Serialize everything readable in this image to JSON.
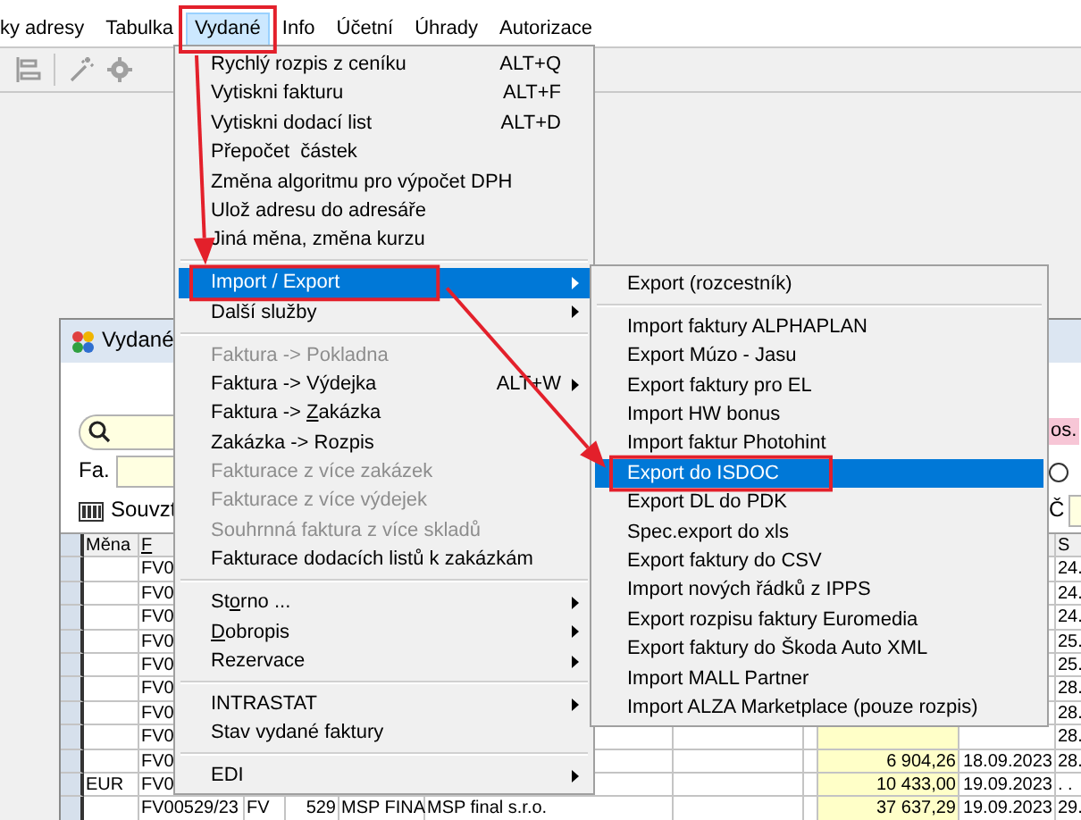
{
  "menu_bar": [
    {
      "label": "ky adresy",
      "selected": false
    },
    {
      "label": "Tabulka",
      "selected": false
    },
    {
      "label": "Vydané",
      "selected": true
    },
    {
      "label": "Info",
      "selected": false
    },
    {
      "label": "Účetní",
      "selected": false
    },
    {
      "label": "Úhrady",
      "selected": false
    },
    {
      "label": "Autorizace",
      "selected": false
    }
  ],
  "vydane_menu": [
    {
      "kind": "item",
      "label": "Rychlý rozpis z ceníku",
      "shortcut": "ALT+Q",
      "disabled": false,
      "selected": false
    },
    {
      "kind": "item",
      "label": "Vytiskni fakturu",
      "shortcut": "ALT+F",
      "disabled": false,
      "selected": false
    },
    {
      "kind": "item",
      "label": "Vytiskni dodací list",
      "shortcut": "ALT+D",
      "disabled": false,
      "selected": false
    },
    {
      "kind": "item",
      "label": "Přepočet  částek",
      "disabled": false,
      "selected": false
    },
    {
      "kind": "item",
      "label": "Změna algoritmu pro výpočet DPH",
      "disabled": false,
      "selected": false
    },
    {
      "kind": "item",
      "label": "Ulož adresu do adresáře",
      "disabled": false,
      "selected": false
    },
    {
      "kind": "item",
      "label": "Jiná měna, změna kurzu",
      "disabled": false,
      "selected": false
    },
    {
      "kind": "separator"
    },
    {
      "kind": "item",
      "label": "Import / Export",
      "submenu": true,
      "disabled": false,
      "selected": true
    },
    {
      "kind": "item",
      "label": "Další služby",
      "submenu": true,
      "disabled": false,
      "selected": false
    },
    {
      "kind": "separator"
    },
    {
      "kind": "item",
      "label": "Faktura -> Pokladna",
      "disabled": true,
      "selected": false
    },
    {
      "kind": "item",
      "label": "Faktura -> Výdejka",
      "shortcut": "ALT+W",
      "submenu": true,
      "disabled": false,
      "selected": false
    },
    {
      "kind": "item",
      "label_parts": [
        {
          "text": "Faktura -> ",
          "underlined": false
        },
        {
          "text": "Z",
          "underlined": true
        },
        {
          "text": "akázka",
          "underlined": false
        }
      ],
      "disabled": false,
      "selected": false
    },
    {
      "kind": "item",
      "label": "Zakázka -> Rozpis",
      "disabled": false,
      "selected": false
    },
    {
      "kind": "item",
      "label": "Fakturace z více zakázek",
      "disabled": true,
      "selected": false
    },
    {
      "kind": "item",
      "label": "Fakturace z více výdejek",
      "disabled": true,
      "selected": false
    },
    {
      "kind": "item",
      "label": "Souhrnná faktura z více skladů",
      "disabled": true,
      "selected": false
    },
    {
      "kind": "item",
      "label": "Fakturace dodacích listů k zakázkám",
      "disabled": false,
      "selected": false
    },
    {
      "kind": "separator"
    },
    {
      "kind": "item",
      "label_parts": [
        {
          "text": "St",
          "underlined": false
        },
        {
          "text": "o",
          "underlined": true
        },
        {
          "text": "rno ...",
          "underlined": false
        }
      ],
      "submenu": true,
      "disabled": false,
      "selected": false
    },
    {
      "kind": "item",
      "label_parts": [
        {
          "text": "D",
          "underlined": true
        },
        {
          "text": "obropis",
          "underlined": false
        }
      ],
      "submenu": true,
      "disabled": false,
      "selected": false
    },
    {
      "kind": "item",
      "label": "Rezervace",
      "submenu": true,
      "disabled": false,
      "selected": false
    },
    {
      "kind": "separator"
    },
    {
      "kind": "item",
      "label": "INTRASTAT",
      "submenu": true,
      "disabled": false,
      "selected": false
    },
    {
      "kind": "item",
      "label": "Stav vydané faktury",
      "disabled": false,
      "selected": false
    },
    {
      "kind": "separator"
    },
    {
      "kind": "item",
      "label": "EDI",
      "submenu": true,
      "disabled": false,
      "selected": false
    }
  ],
  "import_export_menu": [
    {
      "kind": "item",
      "label": "Export (rozcestník)",
      "disabled": false,
      "selected": false
    },
    {
      "kind": "separator"
    },
    {
      "kind": "item",
      "label": "Import faktury ALPHAPLAN",
      "disabled": false,
      "selected": false
    },
    {
      "kind": "item",
      "label": "Export Múzo - Jasu",
      "disabled": false,
      "selected": false
    },
    {
      "kind": "item",
      "label": "Export faktury pro EL",
      "disabled": false,
      "selected": false
    },
    {
      "kind": "item",
      "label": "Import HW bonus",
      "disabled": false,
      "selected": false
    },
    {
      "kind": "item",
      "label": "Import faktur Photohint",
      "disabled": false,
      "selected": false
    },
    {
      "kind": "item",
      "label": "Export do ISDOC",
      "disabled": false,
      "selected": true
    },
    {
      "kind": "item",
      "label": "Export DL do PDK",
      "disabled": false,
      "selected": false
    },
    {
      "kind": "item",
      "label": "Spec.export do xls",
      "disabled": false,
      "selected": false
    },
    {
      "kind": "item",
      "label": "Export faktury do CSV",
      "disabled": false,
      "selected": false
    },
    {
      "kind": "item",
      "label": "Import nových řádků z IPPS",
      "disabled": false,
      "selected": false
    },
    {
      "kind": "item",
      "label": "Export rozpisu faktury Euromedia",
      "disabled": false,
      "selected": false
    },
    {
      "kind": "item",
      "label": "Export faktury do Škoda Auto XML",
      "disabled": false,
      "selected": false
    },
    {
      "kind": "item",
      "label": "Import MALL Partner",
      "disabled": false,
      "selected": false
    },
    {
      "kind": "item",
      "label": "Import ALZA Marketplace (pouze rozpis)",
      "disabled": false,
      "selected": false
    }
  ],
  "document_window": {
    "title": "Vydané",
    "invoice_label": "Fa.",
    "link_label": "Souvzt",
    "status_label": "os.",
    "radio": {
      "checked": false
    },
    "c_label": "Č",
    "table": {
      "header": {
        "column_1": {
          "label": "Měna",
          "underlined": false
        },
        "column_2": {
          "label": "F",
          "underlined": true
        },
        "column_11": {
          "label": "S",
          "underlined": false
        }
      },
      "rows": [
        {
          "column_2": "FV0",
          "column_11": "24."
        },
        {
          "column_2": "FV0",
          "column_11": "24."
        },
        {
          "column_2": "FV0",
          "column_11": "24."
        },
        {
          "column_2": "FV0",
          "column_11": "25."
        },
        {
          "column_2": "FV0",
          "column_11": "25."
        },
        {
          "column_2": "FV0",
          "column_11": "28."
        },
        {
          "column_2": "FV0",
          "column_11": "28."
        },
        {
          "column_2": "FV0",
          "column_11": "28."
        },
        {
          "column_2": "FV0",
          "column_9": "6 904,26",
          "column_10": "18.09.2023",
          "column_11": "28."
        },
        {
          "column_1": "EUR",
          "column_2": "FV0",
          "column_9": "10 433,00",
          "column_10": "19.09.2023",
          "column_11": ". ."
        },
        {
          "column_2": "FV00529/23",
          "column_3": "FV",
          "column_4": "529",
          "column_5": "MSP FINA",
          "column_6": "MSP final s.r.o.",
          "column_9": "37 637,29",
          "column_10": "19.09.2023",
          "column_11": "29."
        }
      ]
    }
  }
}
